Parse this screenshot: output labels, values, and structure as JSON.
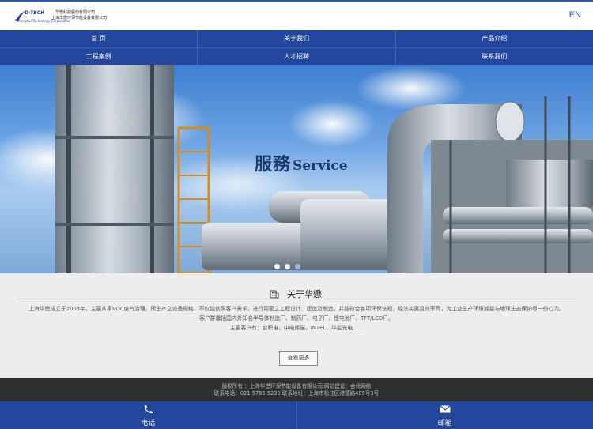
{
  "header": {
    "brand": "D-TECH",
    "brand_cn1": "华懋科技股份有限公司",
    "brand_cn2": "上海华懋环保节能设备有限公司",
    "brand_en": "Shanghai Technology Corporation",
    "lang_label": "EN"
  },
  "nav": {
    "row1": [
      "首 页",
      "关于我们",
      "产品介绍"
    ],
    "row2": [
      "工程案例",
      "人才招聘",
      "联系我们"
    ]
  },
  "banner": {
    "title_cn": "服務",
    "title_en": "Service",
    "slide_count": 3,
    "active_slide": 3
  },
  "about": {
    "title": "关于华懋",
    "p1": "上海华懋成立于2003年，主要从事VOC废气治理。所生产之设备规格，不仅能依照客户需求，进行周密之工程设计、建造及制造，并能符合各项环保法规，经济实惠且效率高，为工业生产环境减量与地球生态保护尽一份心力。",
    "p2": "客户群囊括国内外知名半导体制造厂、制药厂、电子厂、锂电池厂、TFT/LCD厂。",
    "p3": "主要客户有：台积电，中电熊猫，INTEL，华星光电......",
    "more_label": "查看更多"
  },
  "footer": {
    "line1": "版权所有 ：上海华懋环保节能设备有限公司  网站建设：合优网络",
    "line2": "联系电话：021-5785-5230  联系地址：上海市松江区港德路489号3号"
  },
  "bottom_bar": {
    "phone_label": "电话",
    "mail_label": "邮箱"
  },
  "colors": {
    "primary": "#23479c",
    "accent": "#2a59b9",
    "footer_bg": "#2f2f2f",
    "about_bg": "#ededed"
  }
}
